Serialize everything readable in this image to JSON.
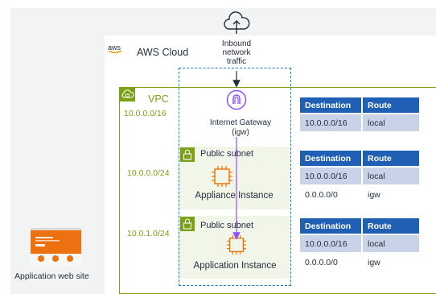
{
  "cloud": {
    "provider_mark": "aws",
    "title": "AWS Cloud"
  },
  "inbound": {
    "lines": [
      "Inbound",
      "network",
      "traffic"
    ]
  },
  "vpc": {
    "name": "VPC",
    "cidr": "10.0.0.0/16"
  },
  "internet_gateway": {
    "line1": "Internet Gateway",
    "line2": "(igw)"
  },
  "subnets": [
    {
      "label": "Public subnet",
      "cidr": "10.0.0.0/24",
      "instance": "Appliance Instance"
    },
    {
      "label": "Public subnet",
      "cidr": "10.0.1.0/24",
      "instance": "Application Instance"
    }
  ],
  "route_tables": [
    {
      "headers": [
        "Destination",
        "Route"
      ],
      "rows": [
        [
          "10.0.0.0/16",
          "local"
        ]
      ]
    },
    {
      "headers": [
        "Destination",
        "Route"
      ],
      "rows": [
        [
          "10.0.0.0/16",
          "local"
        ],
        [
          "0.0.0.0/0",
          "igw"
        ]
      ]
    },
    {
      "headers": [
        "Destination",
        "Route"
      ],
      "rows": [
        [
          "10.0.0.0/16",
          "local"
        ],
        [
          "0.0.0.0/0",
          "igw"
        ]
      ]
    }
  ],
  "website": {
    "label": "Application web site"
  },
  "colors": {
    "vpc_green": "#7aa116",
    "table_header_blue": "#1f5fb4",
    "table_row_blue": "#c9d3e8",
    "gateway_purple": "#8c4fff",
    "instance_orange": "#ed7100",
    "dashed_blue": "#147eba",
    "subnet_fill": "#f2f6e8"
  }
}
